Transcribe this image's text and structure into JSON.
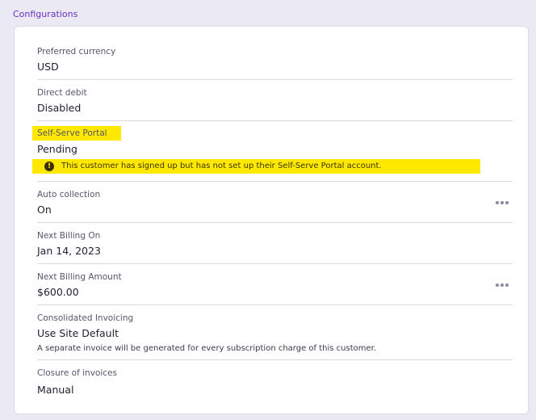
{
  "section": {
    "title": "Configurations"
  },
  "fields": [
    {
      "label": "Preferred currency",
      "value": "USD"
    },
    {
      "label": "Direct debit",
      "value": "Disabled"
    },
    {
      "label": "Self-Serve Portal",
      "value": "Pending",
      "warning": "This customer has signed up but has not set up their Self-Serve Portal account.",
      "warning_icon": "exclamation-circle-icon",
      "highlight_color": "#ffe900"
    },
    {
      "label": "Auto collection",
      "value": "On",
      "menu_icon": "more-horizontal-icon"
    },
    {
      "label": "Next Billing On",
      "value": "Jan 14, 2023"
    },
    {
      "label": "Next Billing Amount",
      "value": "$600.00",
      "menu_icon": "more-horizontal-icon"
    },
    {
      "label": "Consolidated Invoicing",
      "value": "Use Site Default",
      "note": "A separate invoice will be generated for every subscription charge of this customer."
    },
    {
      "label": "Closure of invoices",
      "value": "Manual"
    }
  ],
  "colors": {
    "accent": "#6a2fc2",
    "page_background": "#ebeaf4",
    "highlight": "#ffe900"
  }
}
